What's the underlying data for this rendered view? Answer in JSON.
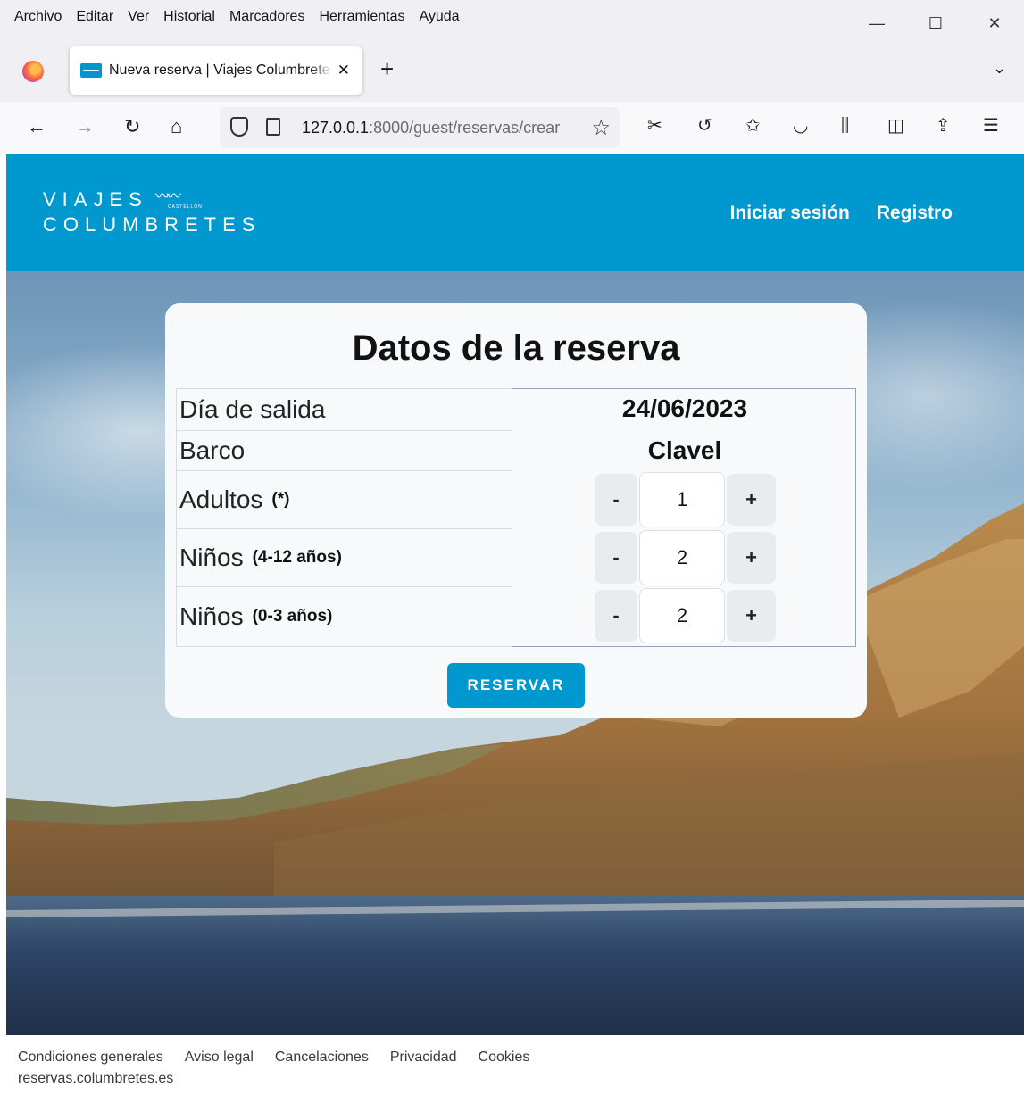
{
  "browser": {
    "menu": [
      "Archivo",
      "Editar",
      "Ver",
      "Historial",
      "Marcadores",
      "Herramientas",
      "Ayuda"
    ],
    "tab_title": "Nueva reserva | Viajes Columbretes",
    "tab_close": "✕",
    "new_tab": "+",
    "url_host": "127.0.0.1",
    "url_rest": ":8000/guest/reservas/crear",
    "win_minimize": "—",
    "win_maximize": "☐",
    "win_close": "✕"
  },
  "site": {
    "logo_line1": "VIAJES",
    "logo_line2": "COLUMBRETES",
    "logo_tag": "CASTELLÓN",
    "nav": {
      "login": "Iniciar sesión",
      "register": "Registro"
    },
    "brand_color": "#0098cf"
  },
  "reservation": {
    "title": "Datos de la reserva",
    "rows": {
      "date_label": "Día de salida",
      "boat_label": "Barco",
      "adults_label": "Adultos",
      "adults_note": "(*)",
      "kids_label": "Niños",
      "kids_note": "(4-12 años)",
      "infants_label": "Niños",
      "infants_note": "(0-3 años)"
    },
    "date_value": "24/06/2023",
    "boat_value": "Clavel",
    "adults_qty": "1",
    "kids_qty": "2",
    "infants_qty": "2",
    "minus": "-",
    "plus": "+",
    "submit": "RESERVAR"
  },
  "footer": {
    "links": [
      "Condiciones generales",
      "Aviso legal",
      "Cancelaciones",
      "Privacidad",
      "Cookies"
    ],
    "domain": "reservas.columbretes.es"
  }
}
